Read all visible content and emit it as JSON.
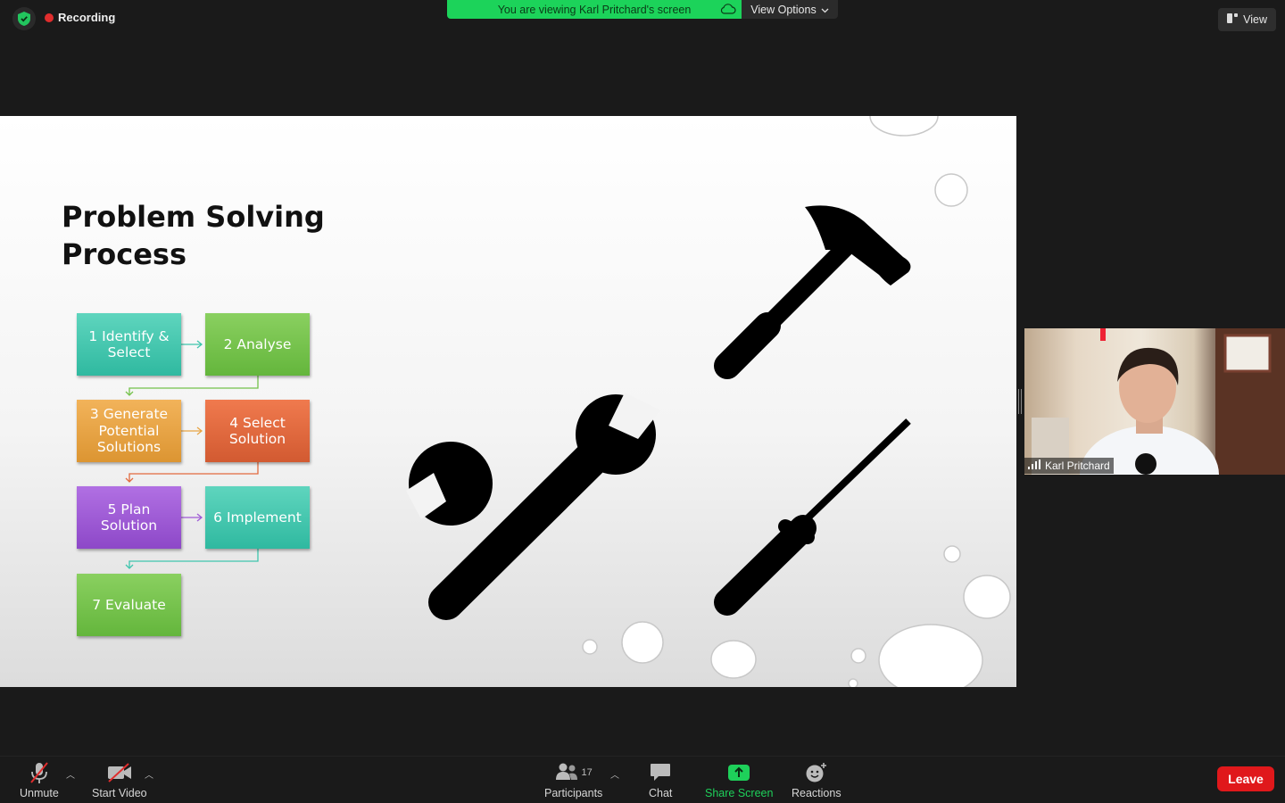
{
  "top_bar": {
    "recording_label": "Recording",
    "viewing_banner": "You are viewing Karl Pritchard's screen",
    "view_options_label": "View Options",
    "view_button_label": "View"
  },
  "slide": {
    "title": "Problem Solving Process",
    "steps": [
      "1 Identify & Select",
      "2 Analyse",
      "3 Generate Potential Solutions",
      "4 Select Solution",
      "5 Plan Solution",
      "6 Implement",
      "7 Evaluate"
    ],
    "step_colors": [
      "#3ec5ad",
      "#74c24b",
      "#e8a545",
      "#e26a3f",
      "#9e5ad6",
      "#3ec5ad",
      "#74c24b"
    ]
  },
  "participant_video": {
    "name": "Karl Pritchard"
  },
  "toolbar": {
    "unmute_label": "Unmute",
    "start_video_label": "Start Video",
    "participants_label": "Participants",
    "participants_count": "17",
    "chat_label": "Chat",
    "share_screen_label": "Share Screen",
    "reactions_label": "Reactions",
    "leave_label": "Leave",
    "share_color": "#1ed05a",
    "leave_color": "#e0181b"
  }
}
